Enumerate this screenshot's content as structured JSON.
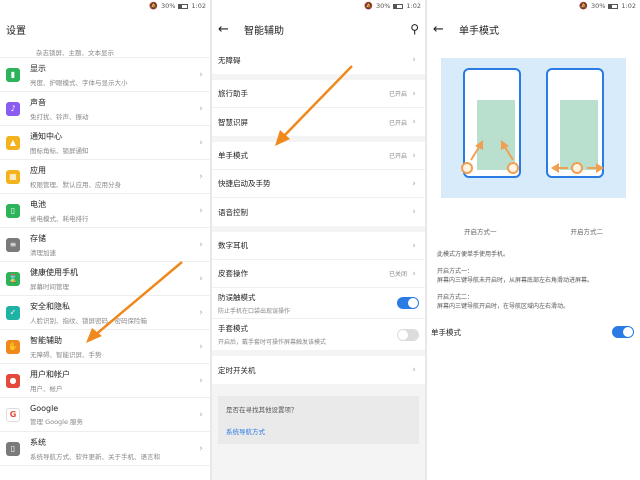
{
  "status": {
    "battery": "30%",
    "time": "1:02"
  },
  "settings": {
    "title": "设置",
    "partial_sub": "杂志锁屏、主题、文本显示",
    "items": [
      {
        "title": "显示",
        "sub": "亮度、护眼模式、字体与显示大小",
        "color": "#2db35a",
        "icon": "▮"
      },
      {
        "title": "声音",
        "sub": "免打扰、铃声、振动",
        "color": "#8a5cf0",
        "icon": "♪"
      },
      {
        "title": "通知中心",
        "sub": "图标角标、锁屏通知",
        "color": "#f2b31d",
        "icon": "▲"
      },
      {
        "title": "应用",
        "sub": "权限管理、默认应用、应用分身",
        "color": "#f2b31d",
        "icon": "▦"
      },
      {
        "title": "电池",
        "sub": "省电模式、耗电排行",
        "color": "#2db35a",
        "icon": "▯"
      },
      {
        "title": "存储",
        "sub": "清理加速",
        "color": "#7a7a7a",
        "icon": "≡"
      },
      {
        "title": "健康使用手机",
        "sub": "屏幕时间管理",
        "color": "#2db35a",
        "icon": "⌛"
      },
      {
        "title": "安全和隐私",
        "sub": "人脸识别、指纹、锁屏密码、密码保险箱",
        "color": "#1fb3a5",
        "icon": "✓"
      },
      {
        "title": "智能辅助",
        "sub": "无障碍、智能识屏、手势",
        "color": "#f0891d",
        "icon": "✋"
      },
      {
        "title": "用户和帐户",
        "sub": "用户、帐户",
        "color": "#e44a3a",
        "icon": "●"
      },
      {
        "title": "Google",
        "sub": "管理 Google 服务",
        "color": "#ffffff",
        "icon": "G"
      },
      {
        "title": "系统",
        "sub": "系统导航方式、软件更新、关于手机、语言和",
        "color": "#7a7a7a",
        "icon": "▯"
      }
    ]
  },
  "assist": {
    "title": "智能辅助",
    "groups": [
      [
        {
          "title": "无障碍",
          "status": ""
        }
      ],
      [
        {
          "title": "旅行助手",
          "status": "已开启"
        },
        {
          "title": "智慧识屏",
          "status": "已开启"
        }
      ],
      [
        {
          "title": "单手模式",
          "status": "已开启"
        },
        {
          "title": "快捷启动及手势",
          "status": ""
        },
        {
          "title": "语音控制",
          "status": ""
        }
      ],
      [
        {
          "title": "数字耳机",
          "status": ""
        },
        {
          "title": "皮套操作",
          "status": "已关闭"
        }
      ],
      [
        {
          "title": "定时开关机",
          "status": ""
        }
      ]
    ],
    "toggles": [
      {
        "title": "防误触模式",
        "sub": "防止手机在口袋出现误操作",
        "state": "on"
      },
      {
        "title": "手套模式",
        "sub": "开启后，戴手套时可操作屏幕触发该模式",
        "state": "off"
      }
    ],
    "help_question": "是否在寻找其他设置项？",
    "help_link": "系统导航方式"
  },
  "onehand": {
    "title": "单手模式",
    "way1": "开启方式一",
    "way2": "开启方式二",
    "desc_intro": "此模式方便单手使用手机。",
    "desc_way1_title": "开启方式一：",
    "desc_way1": "屏幕内三键导航未开启时，从屏幕底部左右角滑动进屏幕。",
    "desc_way2_title": "开启方式二：",
    "desc_way2": "屏幕内三键导航开启时，在导航区域内左右滑动。",
    "toggle_label": "单手模式",
    "toggle_state": "on"
  }
}
